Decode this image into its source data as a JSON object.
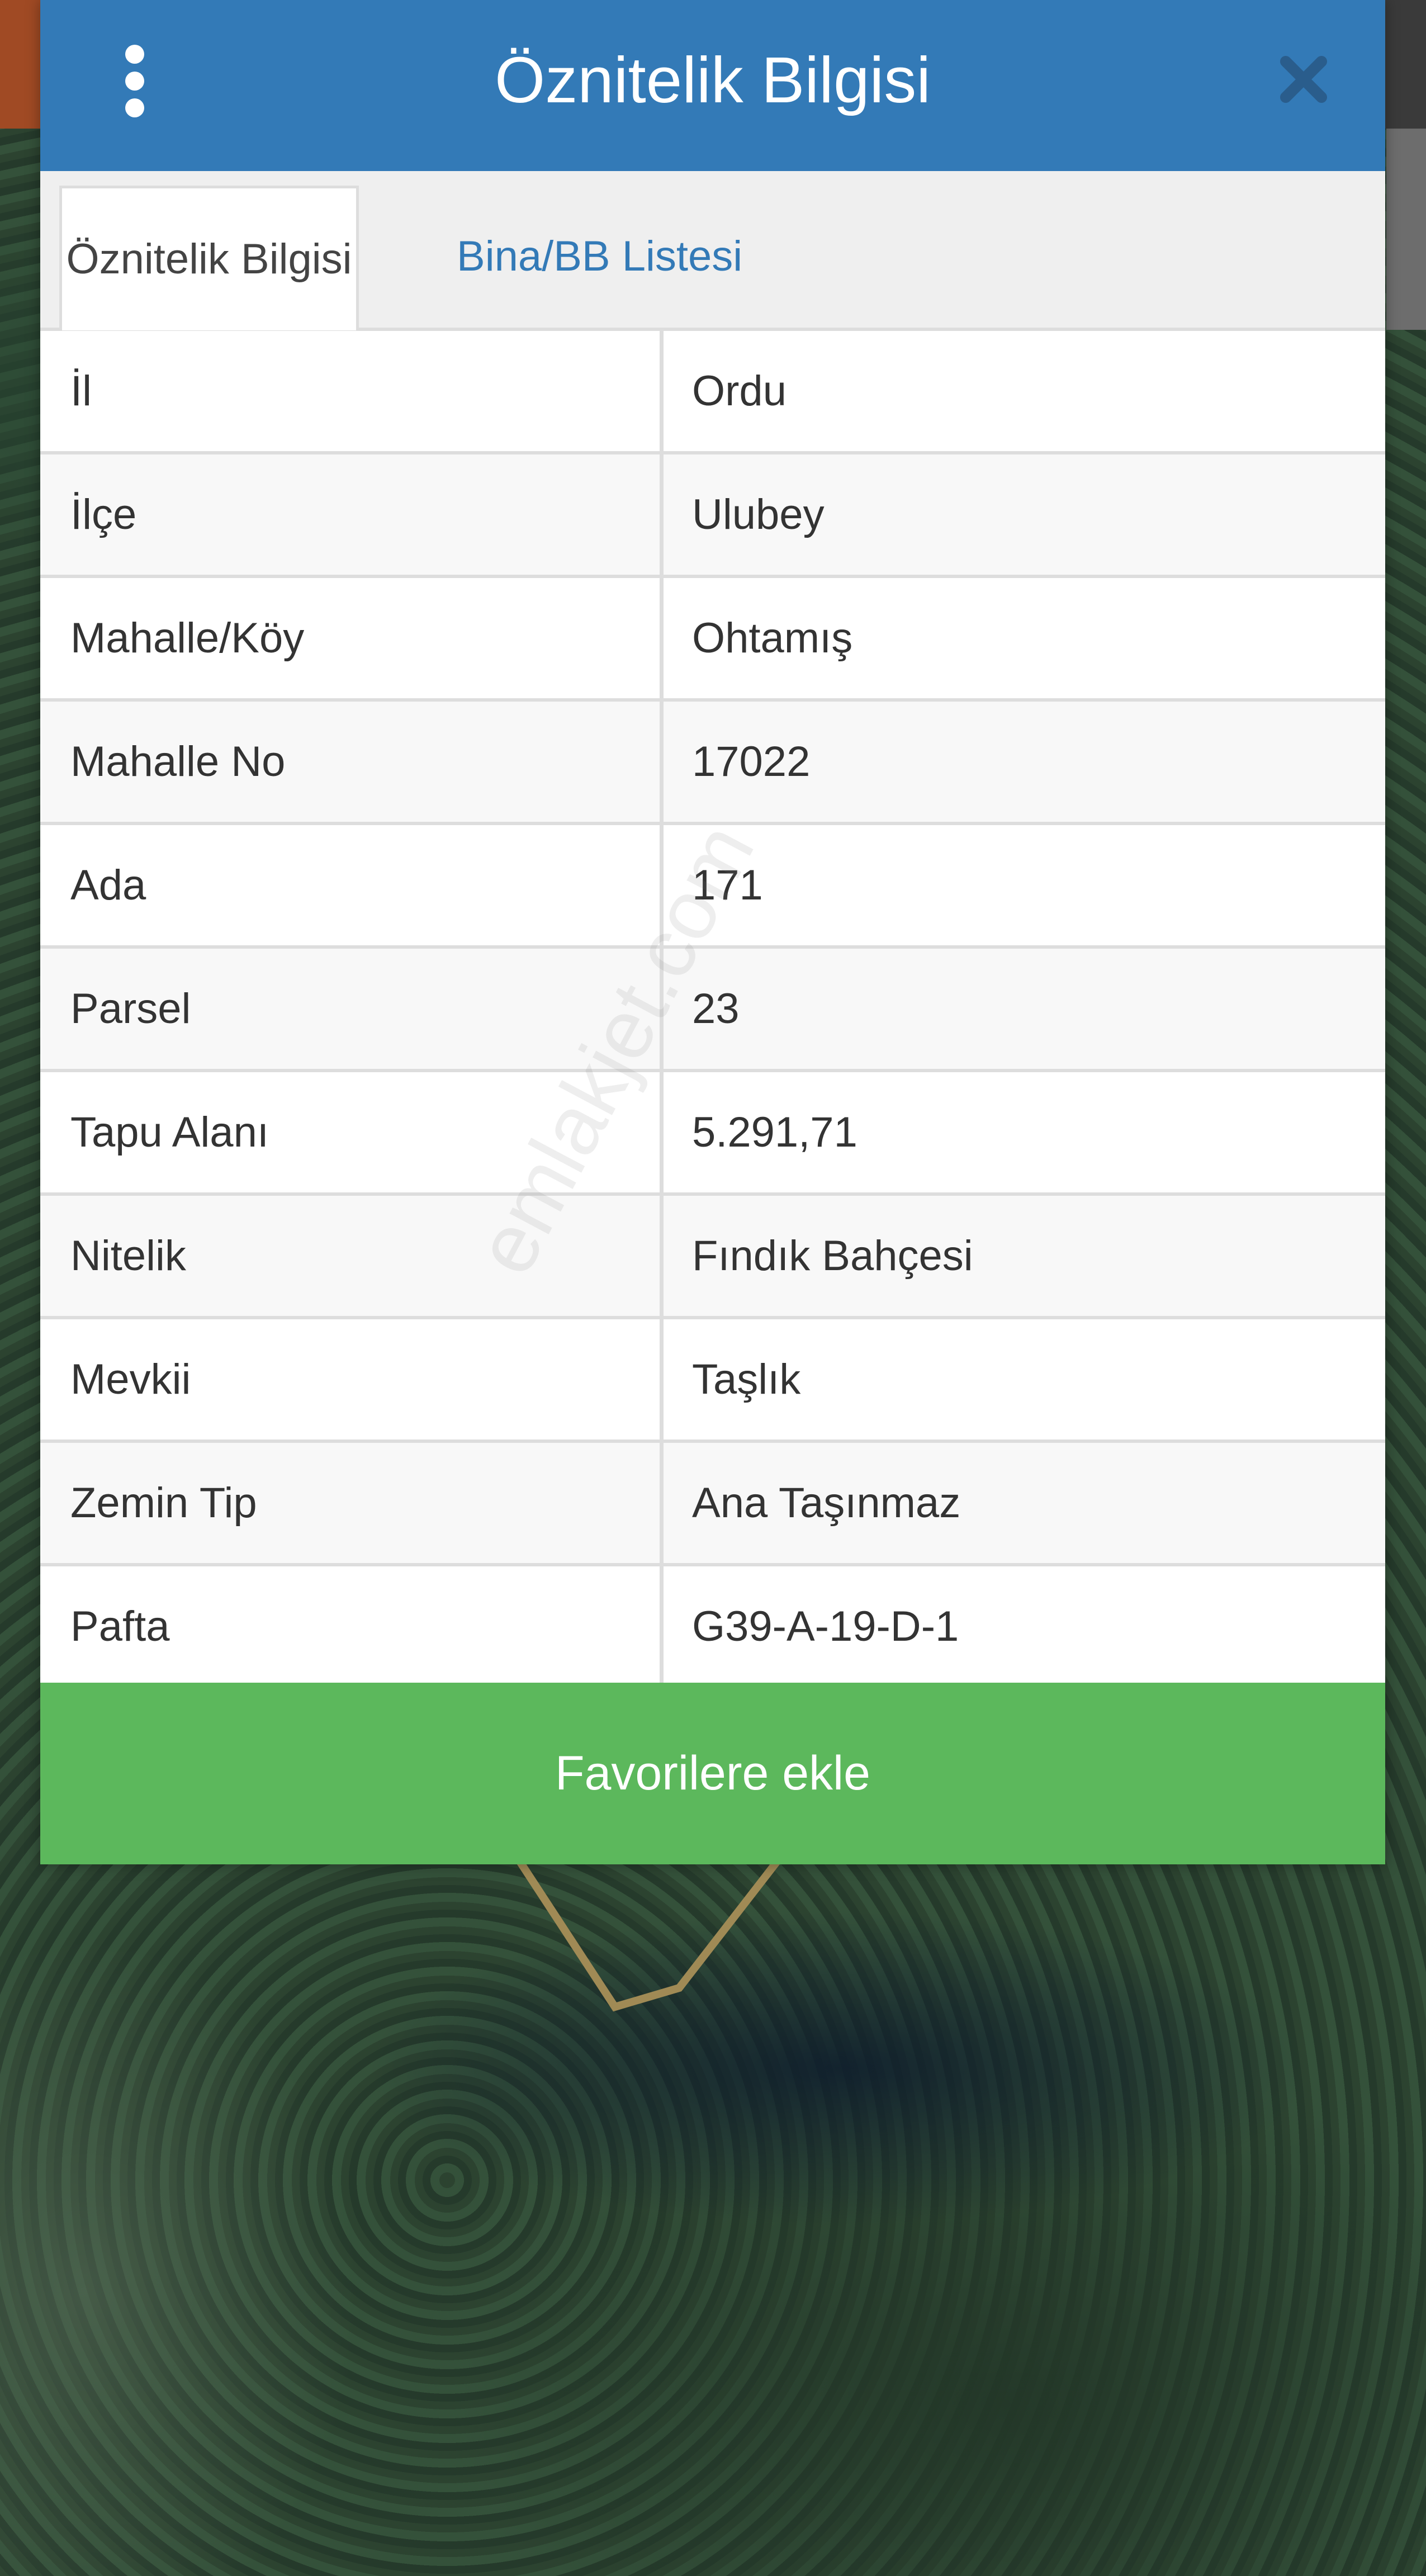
{
  "header": {
    "title": "Öznitelik Bilgisi",
    "menu_icon": "more-vertical-icon",
    "close_icon": "close-icon",
    "color": "#337ab7"
  },
  "tabs": [
    {
      "label": "Öznitelik Bilgisi",
      "active": true
    },
    {
      "label": "Bina/BB Listesi",
      "active": false
    }
  ],
  "attributes": [
    {
      "label": "İl",
      "value": "Ordu"
    },
    {
      "label": "İlçe",
      "value": "Ulubey"
    },
    {
      "label": "Mahalle/Köy",
      "value": "Ohtamış"
    },
    {
      "label": "Mahalle No",
      "value": "17022"
    },
    {
      "label": "Ada",
      "value": "171"
    },
    {
      "label": "Parsel",
      "value": "23"
    },
    {
      "label": "Tapu Alanı",
      "value": "5.291,71"
    },
    {
      "label": "Nitelik",
      "value": "Fındık Bahçesi"
    },
    {
      "label": "Mevkii",
      "value": "Taşlık"
    },
    {
      "label": "Zemin Tip",
      "value": "Ana Taşınmaz"
    },
    {
      "label": "Pafta",
      "value": "G39-A-19-D-1"
    }
  ],
  "favorite_button": {
    "label": "Favorilere ekle",
    "color": "#5cb85c"
  },
  "watermark": "emlakjet.com"
}
